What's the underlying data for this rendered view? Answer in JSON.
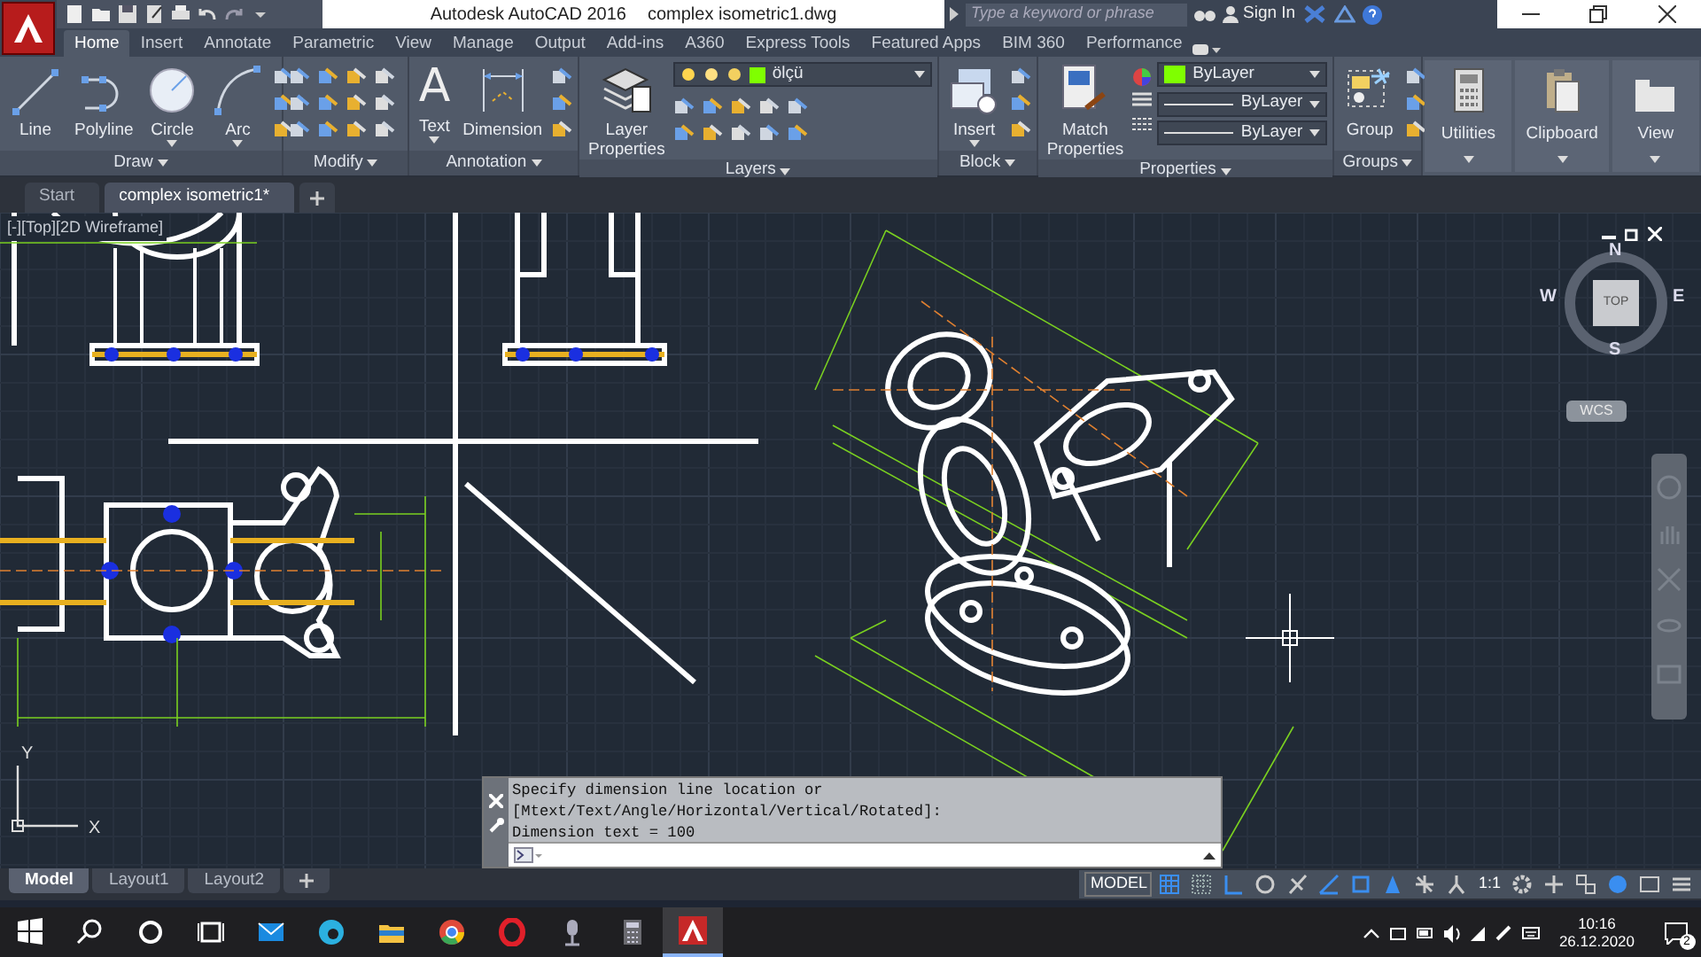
{
  "title_bar": {
    "app": "Autodesk AutoCAD 2016",
    "document": "complex isometric1.dwg",
    "search": {
      "placeholder": "Type a keyword or phrase"
    },
    "sign_in": "Sign In"
  },
  "ribbon_tabs": [
    {
      "label": "Home",
      "selected": true
    },
    {
      "label": "Insert",
      "selected": false
    },
    {
      "label": "Annotate",
      "selected": false
    },
    {
      "label": "Parametric",
      "selected": false
    },
    {
      "label": "View",
      "selected": false
    },
    {
      "label": "Manage",
      "selected": false
    },
    {
      "label": "Output",
      "selected": false
    },
    {
      "label": "Add-ins",
      "selected": false
    },
    {
      "label": "A360",
      "selected": false
    },
    {
      "label": "Express Tools",
      "selected": false
    },
    {
      "label": "Featured Apps",
      "selected": false
    },
    {
      "label": "BIM 360",
      "selected": false
    },
    {
      "label": "Performance",
      "selected": false
    }
  ],
  "ribbon_panels": [
    {
      "kind": "draw",
      "title": "Draw",
      "tools": [
        {
          "kind": "line",
          "label": "Line"
        },
        {
          "kind": "polyline",
          "label": "Polyline"
        },
        {
          "kind": "circle",
          "label": "Circle"
        },
        {
          "kind": "arc",
          "label": "Arc"
        }
      ]
    },
    {
      "kind": "modify",
      "title": "Modify"
    },
    {
      "kind": "annotation",
      "title": "Annotation",
      "tools": [
        {
          "kind": "text",
          "label": "Text",
          "glyph": "A"
        },
        {
          "kind": "dimension",
          "label": "Dimension"
        }
      ]
    },
    {
      "kind": "layers",
      "title": "Layers",
      "layer": "ölçü",
      "tools": [
        {
          "kind": "layers",
          "label": "Layer Properties"
        }
      ]
    },
    {
      "kind": "block",
      "title": "Block",
      "tools": [
        {
          "kind": "insert",
          "label": "Insert"
        }
      ]
    },
    {
      "kind": "properties",
      "title": "Properties",
      "dropdowns": [
        "ByLayer",
        "ByLayer",
        "ByLayer"
      ],
      "tools": [
        {
          "kind": "match",
          "label": "Match Properties"
        }
      ]
    },
    {
      "kind": "groups",
      "title": "Groups",
      "tools": [
        {
          "kind": "group",
          "label": "Group"
        }
      ]
    },
    {
      "kind": "collapsed",
      "tools": [
        {
          "kind": "utilities",
          "label": "Utilities"
        }
      ]
    },
    {
      "kind": "collapsed",
      "tools": [
        {
          "kind": "clipboard",
          "label": "Clipboard"
        }
      ]
    },
    {
      "kind": "collapsed",
      "tools": [
        {
          "kind": "view",
          "label": "View"
        }
      ]
    }
  ],
  "doc_tabs": [
    {
      "label": "Start",
      "selected": false
    },
    {
      "label": "complex isometric1*",
      "selected": true
    }
  ],
  "viewport": {
    "label": "[-][Top][2D Wireframe]",
    "compass": {
      "north": "N",
      "east": "E",
      "south": "S",
      "west": "W",
      "cube": "TOP"
    },
    "ucs_menu": "WCS",
    "ucs_axes": {
      "x": "X",
      "y": "Y"
    }
  },
  "command_line": {
    "history": [
      "Specify dimension line location or",
      "[Mtext/Text/Angle/Horizontal/Vertical/Rotated]:",
      "Dimension text = 100"
    ]
  },
  "layout_tabs": [
    {
      "label": "Model",
      "selected": true
    },
    {
      "label": "Layout1",
      "selected": false
    },
    {
      "label": "Layout2",
      "selected": false
    }
  ],
  "status_bar": {
    "space": "MODEL",
    "scale": "1:1"
  },
  "taskbar": {
    "time": "10:16",
    "date": "26.12.2020",
    "notifications": "2"
  }
}
